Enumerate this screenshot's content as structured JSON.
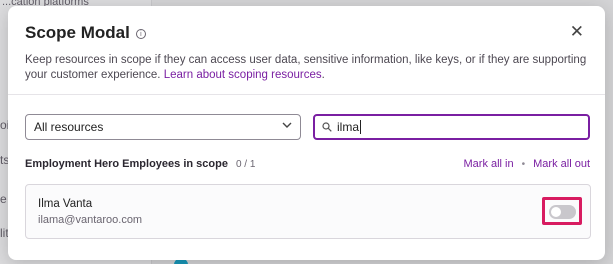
{
  "background": {
    "fragment_top": "...cation platforms",
    "fragment_a": "oil",
    "fragment_b": "ts",
    "fragment_c": "e",
    "fragment_d": "lity"
  },
  "modal": {
    "title": "Scope Modal",
    "info_icon": "info-icon",
    "close_icon": "✕",
    "description": "Keep resources in scope if they can access user data, sensitive information, like keys, or if they are supporting your customer experience.",
    "learn_link": "Learn about scoping resources",
    "filter_select_value": "All resources",
    "search_value": "ilma",
    "list_title": "Employment Hero Employees in scope",
    "list_count": "0 / 1",
    "mark_all_in": "Mark all in",
    "mark_all_out": "Mark all out",
    "separator": "•",
    "person": {
      "name": "Ilma Vanta",
      "email": "ilama@vantaroo.com",
      "in_scope": false
    }
  },
  "colors": {
    "accent": "#7a1fa2",
    "highlight": "#d81b60",
    "toggle_off": "#c9c7cc"
  }
}
